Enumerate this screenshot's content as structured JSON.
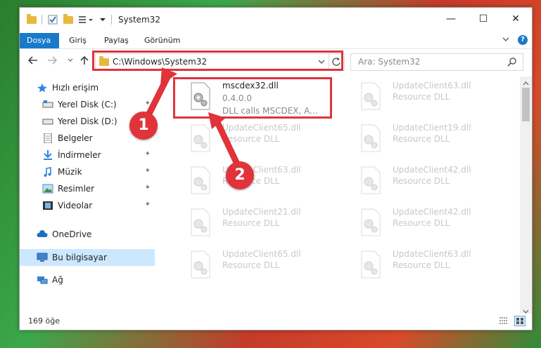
{
  "window": {
    "title": "System32",
    "controls": {
      "minimize": "—",
      "maximize": "☐",
      "close": "✕"
    }
  },
  "ribbon": {
    "tabs": [
      {
        "label": "Dosya",
        "active": true
      },
      {
        "label": "Giriş"
      },
      {
        "label": "Paylaş"
      },
      {
        "label": "Görünüm"
      }
    ]
  },
  "address": {
    "path": "C:\\Windows\\System32",
    "search_placeholder": "Ara: System32"
  },
  "sidebar": {
    "items": [
      {
        "label": "Hızlı erişim",
        "icon": "star-icon"
      },
      {
        "label": "Yerel Disk (C:)",
        "icon": "drive-icon"
      },
      {
        "label": "Yerel Disk (D:)",
        "icon": "drive-icon"
      },
      {
        "label": "Belgeler",
        "icon": "documents-icon"
      },
      {
        "label": "İndirmeler",
        "icon": "download-icon"
      },
      {
        "label": "Müzik",
        "icon": "music-icon"
      },
      {
        "label": "Resimler",
        "icon": "pictures-icon"
      },
      {
        "label": "Videolar",
        "icon": "video-icon"
      },
      {
        "label": "OneDrive",
        "icon": "cloud-icon"
      },
      {
        "label": "Bu bilgisayar",
        "icon": "computer-icon"
      },
      {
        "label": "Ağ",
        "icon": "network-icon"
      }
    ]
  },
  "files": [
    {
      "name": "mscdex32.dll",
      "version": "0.4.0.0",
      "desc": "DLL calls MSCDEX, A..."
    },
    {
      "name": "UpdateClient63.dll",
      "desc": "Resource DLL"
    },
    {
      "name": "UpdateClient65.dll",
      "desc": "Resource DLL"
    },
    {
      "name": "UpdateClient19.dll",
      "desc": "Resource DLL"
    },
    {
      "name": "UpdateClient63.dll",
      "desc": "Resource DLL"
    },
    {
      "name": "UpdateClient42.dll",
      "desc": "Resource DLL"
    },
    {
      "name": "UpdateClient21.dll",
      "desc": "Resource DLL"
    },
    {
      "name": "UpdateClient42.dll",
      "desc": "Resource DLL"
    },
    {
      "name": "UpdateClient65.dll",
      "desc": "Resource DLL"
    },
    {
      "name": "UpdateClient63.dll",
      "desc": "Resource DLL"
    }
  ],
  "status": {
    "count": "169 öğe"
  },
  "annotations": {
    "step1": "1",
    "step2": "2",
    "color": "#e0333a"
  }
}
